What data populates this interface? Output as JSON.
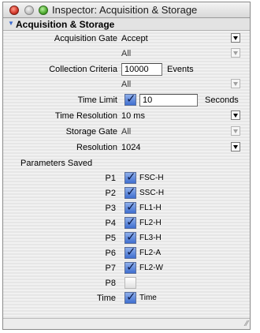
{
  "window": {
    "title": "Inspector: Acquisition & Storage"
  },
  "section": {
    "title": "Acquisition & Storage"
  },
  "acquisition_gate": {
    "label": "Acquisition Gate",
    "value": "Accept",
    "sub_value": "All"
  },
  "collection_criteria": {
    "label": "Collection Criteria",
    "value": "10000",
    "unit": "Events",
    "sub_value": "All"
  },
  "time_limit": {
    "label": "Time Limit",
    "checked": true,
    "value": "10",
    "unit": "Seconds"
  },
  "time_resolution": {
    "label": "Time Resolution",
    "value": "10 ms"
  },
  "storage_gate": {
    "label": "Storage Gate",
    "value": "All"
  },
  "resolution": {
    "label": "Resolution",
    "value": "1024"
  },
  "parameters": {
    "heading": "Parameters Saved",
    "items": [
      {
        "label": "P1",
        "checked": true,
        "name": "FSC-H"
      },
      {
        "label": "P2",
        "checked": true,
        "name": "SSC-H"
      },
      {
        "label": "P3",
        "checked": true,
        "name": "FL1-H"
      },
      {
        "label": "P4",
        "checked": true,
        "name": "FL2-H"
      },
      {
        "label": "P5",
        "checked": true,
        "name": "FL3-H"
      },
      {
        "label": "P6",
        "checked": true,
        "name": "FL2-A"
      },
      {
        "label": "P7",
        "checked": true,
        "name": "FL2-W"
      },
      {
        "label": "P8",
        "checked": false,
        "name": ""
      },
      {
        "label": "Time",
        "checked": true,
        "name": "Time"
      }
    ]
  },
  "icons": {
    "check": "✓",
    "grip": "⁄⁄"
  }
}
